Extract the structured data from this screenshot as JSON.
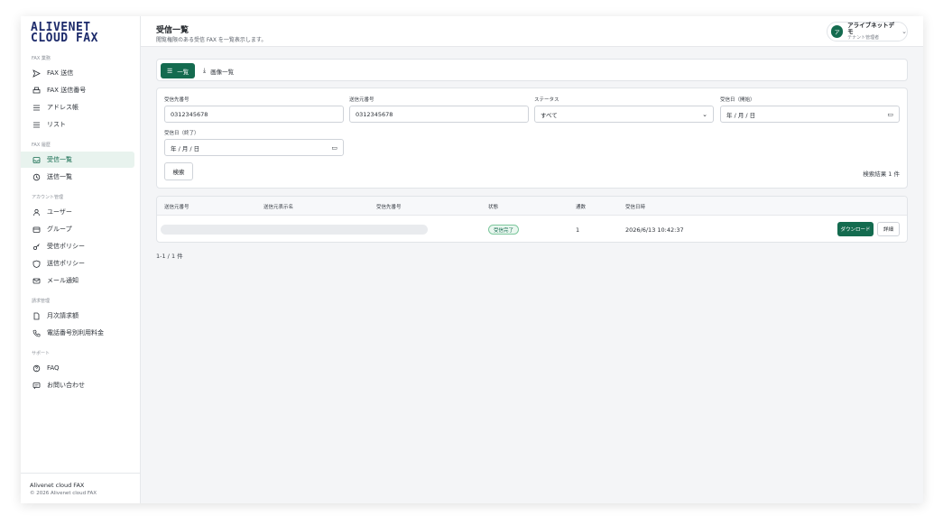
{
  "sidebar": {
    "logo_line1": "ALIVENET",
    "logo_line2": "CLOUD FAX",
    "sections": [
      {
        "title": "FAX 業務",
        "items": [
          {
            "label": "FAX 送信",
            "icon": "send-icon"
          },
          {
            "label": "FAX 送信番号",
            "icon": "printer-icon"
          },
          {
            "label": "アドレス帳",
            "icon": "list-icon"
          },
          {
            "label": "リスト",
            "icon": "list-icon"
          }
        ]
      },
      {
        "title": "FAX 履歴",
        "items": [
          {
            "label": "受信一覧",
            "icon": "inbox-icon",
            "active": true
          },
          {
            "label": "送信一覧",
            "icon": "history-icon"
          }
        ]
      },
      {
        "title": "アカウント管理",
        "items": [
          {
            "label": "ユーザー",
            "icon": "users-icon"
          },
          {
            "label": "グループ",
            "icon": "group-icon"
          },
          {
            "label": "受信ポリシー",
            "icon": "key-icon"
          },
          {
            "label": "送信ポリシー",
            "icon": "shield-icon"
          },
          {
            "label": "メール通知",
            "icon": "mail-icon"
          }
        ]
      },
      {
        "title": "請求管理",
        "items": [
          {
            "label": "月次請求額",
            "icon": "document-icon"
          },
          {
            "label": "電話番号別利用料金",
            "icon": "phone-icon"
          }
        ]
      },
      {
        "title": "サポート",
        "items": [
          {
            "label": "FAQ",
            "icon": "help-icon"
          },
          {
            "label": "お問い合わせ",
            "icon": "chat-icon"
          }
        ]
      }
    ],
    "footer_title": "Alivenet cloud FAX",
    "footer_copy": "© 2026 Alivenet cloud FAX"
  },
  "header": {
    "title": "受信一覧",
    "subtitle": "閲覧権限のある受信 FAX を一覧表示します。",
    "user_initial": "ア",
    "user_name": "アライブネットデモ",
    "user_role": "テナント管理者"
  },
  "view_tabs": {
    "list_label": "一覧",
    "image_label": "画像一覧"
  },
  "filters": {
    "recipient_number_label": "受信先番号",
    "recipient_number_value": "0312345678",
    "sender_number_label": "送信元番号",
    "sender_number_value": "0312345678",
    "status_label": "ステータス",
    "status_value": "すべて",
    "date_from_label": "受信日（開始）",
    "date_from_value": "年 / 月 / 日",
    "date_to_label": "受信日（終了）",
    "date_to_value": "年 / 月 / 日",
    "search_label": "検索",
    "result_count": "検索結果 1 件"
  },
  "table": {
    "columns": [
      "送信元番号",
      "送信元表示名",
      "受信先番号",
      "状態",
      "通数",
      "受信日時"
    ],
    "rows": [
      {
        "status": "受信完了",
        "pages": "1",
        "received_at": "2026/6/13 10:42:37"
      }
    ],
    "download_label": "ダウンロード",
    "detail_label": "詳細"
  },
  "pagination": "1-1 / 1 件",
  "colors": {
    "accent": "#146b4f",
    "logo": "#1d2b6b"
  }
}
